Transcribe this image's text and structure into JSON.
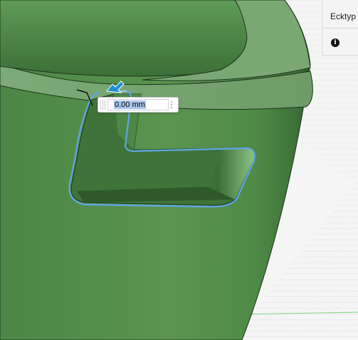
{
  "dimension_input": {
    "value": "0.00 mm",
    "menu_icon": "vertical-dots-icon"
  },
  "properties_panel": {
    "corner_type_label": "Ecktyp",
    "info_icon": "info-icon",
    "info_glyph": "i"
  },
  "colors": {
    "model_green": "#4e8a4a",
    "model_top_face": "#7aa874",
    "selection_blue": "#5ea7e4",
    "manipulator_arrow": "#1a8fd6",
    "grid_line": "#d0d0d4",
    "panel_bg": "#f4f4f5"
  }
}
